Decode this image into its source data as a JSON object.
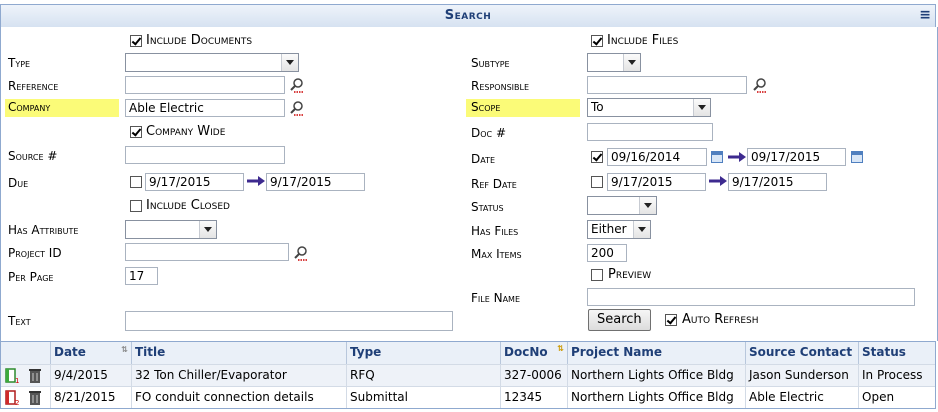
{
  "title": "Search",
  "form": {
    "include_documents": "Include Documents",
    "include_files": "Include Files",
    "type": "Type",
    "subtype": "Subtype",
    "reference": "Reference",
    "responsible": "Responsible",
    "company": "Company",
    "company_value": "Able Electric",
    "scope": "Scope",
    "scope_value": "To",
    "company_wide": "Company Wide",
    "doc_no": "Doc #",
    "source_no": "Source #",
    "date": "Date",
    "date_from": "09/16/2014",
    "date_to": "09/17/2015",
    "due": "Due",
    "due_from": "9/17/2015",
    "due_to": "9/17/2015",
    "ref_date": "Ref Date",
    "ref_from": "9/17/2015",
    "ref_to": "9/17/2015",
    "include_closed": "Include Closed",
    "status": "Status",
    "has_attribute": "Has Attribute",
    "has_files": "Has Files",
    "has_files_value": "Either",
    "project_id": "Project ID",
    "max_items": "Max Items",
    "max_items_value": "200",
    "per_page": "Per Page",
    "per_page_value": "17",
    "preview": "Preview",
    "file_name": "File Name",
    "text": "Text",
    "search_button": "Search",
    "auto_refresh": "Auto Refresh"
  },
  "grid": {
    "headers": [
      "Date",
      "Title",
      "Type",
      "DocNo",
      "Project Name",
      "Source Contact",
      "Status"
    ],
    "rows": [
      {
        "date": "9/4/2015",
        "title": "32 Ton Chiller/Evaporator",
        "type": "RFQ",
        "docno": "327-0006",
        "project": "Northern Lights Office Bldg",
        "contact": "Jason Sunderson",
        "status": "In Process"
      },
      {
        "date": "8/21/2015",
        "title": "FO conduit connection details",
        "type": "Submittal",
        "docno": "12345",
        "project": "Northern Lights Office Bldg",
        "contact": "Able Electric",
        "status": "Open"
      }
    ]
  },
  "colors": {
    "header_blue": "#1f3f77",
    "highlight": "#fbfb78",
    "border": "#8fa9cf"
  }
}
